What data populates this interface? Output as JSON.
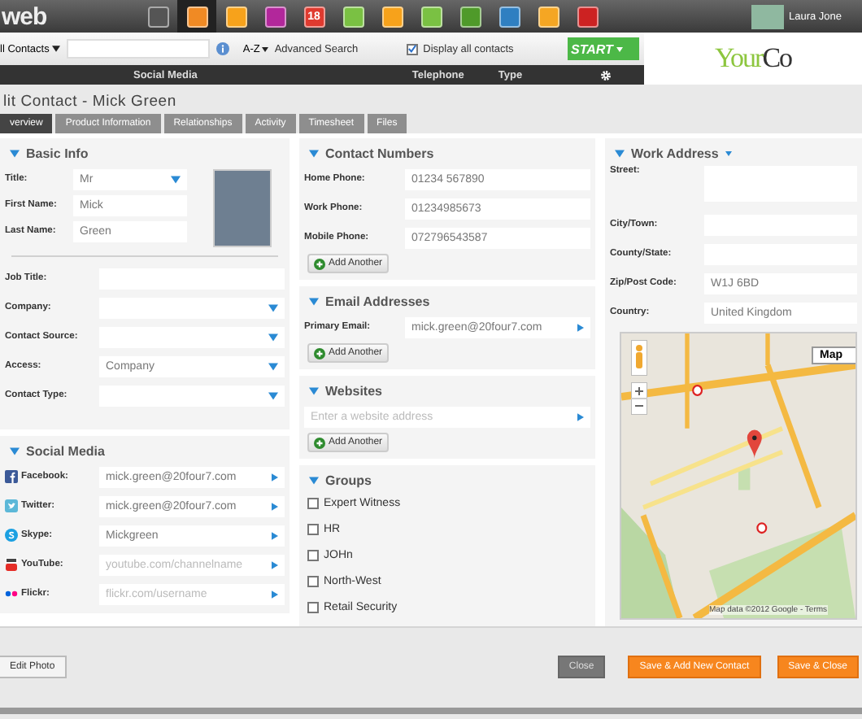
{
  "top_bar": {
    "logo": "web",
    "apps": [
      {
        "color": "#555555",
        "selected": false
      },
      {
        "color": "#f08a24",
        "selected": true
      },
      {
        "color": "#f7a21b",
        "selected": false
      },
      {
        "color": "#b2279b",
        "selected": false
      },
      {
        "color": "#e03a2f",
        "selected": false,
        "label": "18"
      },
      {
        "color": "#7ac143",
        "selected": false
      },
      {
        "color": "#f7a21b",
        "selected": false
      },
      {
        "color": "#7ac143",
        "selected": false
      },
      {
        "color": "#4f9a2a",
        "selected": false
      },
      {
        "color": "#2f7fc1",
        "selected": false
      },
      {
        "color": "#f5a623",
        "selected": false
      },
      {
        "color": "#cc2222",
        "selected": false
      }
    ],
    "user": {
      "name": "Laura Jone"
    }
  },
  "toolbar": {
    "list_filter": "ll Contacts",
    "sort": "A-Z",
    "advanced_search": "Advanced Search",
    "display_all": {
      "label": "Display all contacts",
      "checked": true
    },
    "start": "START"
  },
  "brand": {
    "part_1": "Your",
    "part_2": "Co"
  },
  "list_header": {
    "columns": [
      "Social Media",
      "Telephone",
      "Type"
    ]
  },
  "dialog": {
    "title": "lit Contact - Mick Green",
    "tabs": [
      {
        "label": "verview",
        "selected": true
      },
      {
        "label": "Product Information",
        "selected": false
      },
      {
        "label": "Relationships",
        "selected": false
      },
      {
        "label": "Activity",
        "selected": false
      },
      {
        "label": "Timesheet",
        "selected": false
      },
      {
        "label": "Files",
        "selected": false
      }
    ]
  },
  "basic_info": {
    "title": "Basic Info",
    "name_fields": [
      {
        "label": "Title:",
        "kind": "select",
        "value": "Mr"
      },
      {
        "label": "First Name:",
        "kind": "text",
        "value": "Mick"
      },
      {
        "label": "Last Name:",
        "kind": "text",
        "value": "Green"
      }
    ],
    "fields": [
      {
        "label": "Job Title:",
        "kind": "text"
      },
      {
        "label": "Company:",
        "kind": "select"
      },
      {
        "label": "Contact Source:",
        "kind": "select"
      },
      {
        "label": "Access:",
        "kind": "select",
        "value": "Company"
      },
      {
        "label": "Contact Type:",
        "kind": "select"
      }
    ]
  },
  "social_media": {
    "title": "Social Media",
    "fields": [
      {
        "label": "Facebook:",
        "kind": "facebook",
        "value": "mick.green@20four7.com"
      },
      {
        "label": "Twitter:",
        "kind": "twitter",
        "value": "mick.green@20four7.com"
      },
      {
        "label": "Skype:",
        "kind": "skype",
        "value": "Mickgreen"
      },
      {
        "label": "YouTube:",
        "kind": "youtube",
        "placeholder": "youtube.com/channelname"
      },
      {
        "label": "Flickr:",
        "kind": "flickr",
        "placeholder": "flickr.com/username"
      }
    ]
  },
  "contact_numbers": {
    "title": "Contact Numbers",
    "fields": [
      {
        "label": "Home Phone:",
        "kind": "text",
        "value": "01234 567890"
      },
      {
        "label": "Work Phone:",
        "kind": "text",
        "value": "01234985673"
      },
      {
        "label": "Mobile Phone:",
        "kind": "text",
        "value": "072796543587"
      }
    ],
    "add_button": "Add Another"
  },
  "email_addresses": {
    "title": "Email Addresses",
    "fields": [
      {
        "label": "Primary Email:",
        "kind": "link",
        "value": "mick.green@20four7.com"
      }
    ],
    "add_button": "Add Another"
  },
  "websites": {
    "title": "Websites",
    "placeholder": "Enter a website address",
    "add_button": "Add Another"
  },
  "groups": {
    "title": "Groups",
    "items": [
      {
        "label": "Expert Witness",
        "checked": false
      },
      {
        "label": "HR",
        "checked": false
      },
      {
        "label": "JOHn",
        "checked": false
      },
      {
        "label": "North-West",
        "checked": false
      },
      {
        "label": "Retail Security",
        "checked": false
      }
    ]
  },
  "work_address": {
    "title": "Work Address",
    "fields": [
      {
        "label": "Street:",
        "kind": "textarea"
      },
      {
        "label": "City/Town:",
        "kind": "text"
      },
      {
        "label": "County/State:",
        "kind": "text"
      },
      {
        "label": "Zip/Post Code:",
        "kind": "text",
        "value": "W1J 6BD"
      },
      {
        "label": "Country:",
        "kind": "text",
        "value": "United Kingdom"
      }
    ],
    "map": {
      "type_button": "Map",
      "attribution": "Map data ©2012 Google - Terms"
    }
  },
  "footer": {
    "edit_photo": "Edit Photo",
    "buttons": [
      {
        "label": "Close",
        "kind": "secondary"
      },
      {
        "label": "Save & Add New Contact",
        "kind": "primary"
      },
      {
        "label": "Save & Close",
        "kind": "primary"
      }
    ]
  }
}
